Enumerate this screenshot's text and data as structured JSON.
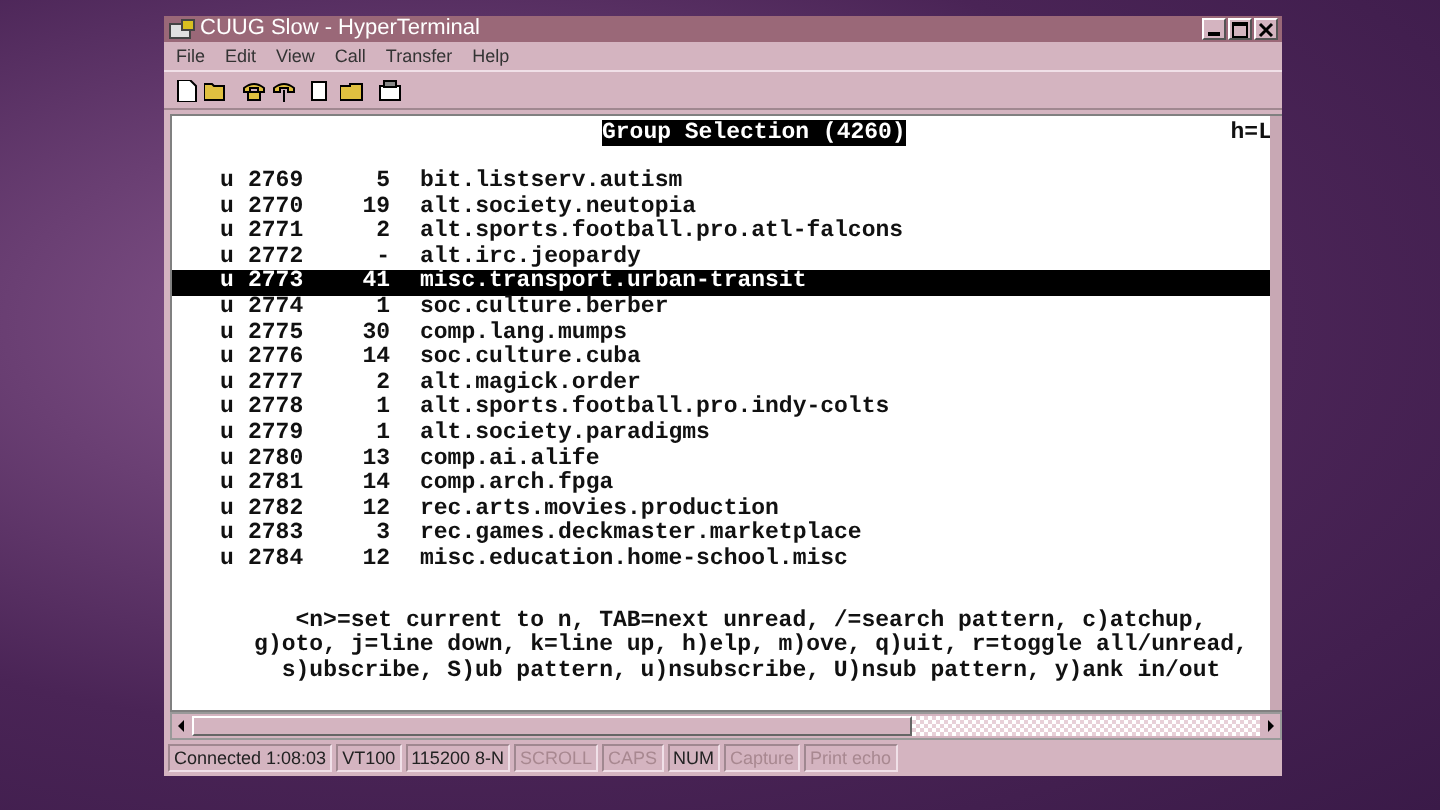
{
  "window": {
    "title": "CUUG Slow - HyperTerminal"
  },
  "menu": [
    "File",
    "Edit",
    "View",
    "Call",
    "Transfer",
    "Help"
  ],
  "terminal": {
    "header": "Group Selection (4260)",
    "header_right": "h=L",
    "rows": [
      {
        "flag": "u",
        "number": "2769",
        "count": "5",
        "group": "bit.listserv.autism",
        "selected": false
      },
      {
        "flag": "u",
        "number": "2770",
        "count": "19",
        "group": "alt.society.neutopia",
        "selected": false
      },
      {
        "flag": "u",
        "number": "2771",
        "count": "2",
        "group": "alt.sports.football.pro.atl-falcons",
        "selected": false
      },
      {
        "flag": "u",
        "number": "2772",
        "count": "-",
        "group": "alt.irc.jeopardy",
        "selected": false
      },
      {
        "flag": "u",
        "number": "2773",
        "count": "41",
        "group": "misc.transport.urban-transit",
        "selected": true
      },
      {
        "flag": "u",
        "number": "2774",
        "count": "1",
        "group": "soc.culture.berber",
        "selected": false
      },
      {
        "flag": "u",
        "number": "2775",
        "count": "30",
        "group": "comp.lang.mumps",
        "selected": false
      },
      {
        "flag": "u",
        "number": "2776",
        "count": "14",
        "group": "soc.culture.cuba",
        "selected": false
      },
      {
        "flag": "u",
        "number": "2777",
        "count": "2",
        "group": "alt.magick.order",
        "selected": false
      },
      {
        "flag": "u",
        "number": "2778",
        "count": "1",
        "group": "alt.sports.football.pro.indy-colts",
        "selected": false
      },
      {
        "flag": "u",
        "number": "2779",
        "count": "1",
        "group": "alt.society.paradigms",
        "selected": false
      },
      {
        "flag": "u",
        "number": "2780",
        "count": "13",
        "group": "comp.ai.alife",
        "selected": false
      },
      {
        "flag": "u",
        "number": "2781",
        "count": "14",
        "group": "comp.arch.fpga",
        "selected": false
      },
      {
        "flag": "u",
        "number": "2782",
        "count": "12",
        "group": "rec.arts.movies.production",
        "selected": false
      },
      {
        "flag": "u",
        "number": "2783",
        "count": "3",
        "group": "rec.games.deckmaster.marketplace",
        "selected": false
      },
      {
        "flag": "u",
        "number": "2784",
        "count": "12",
        "group": "misc.education.home-school.misc",
        "selected": false
      }
    ],
    "help": [
      "<n>=set current to n, TAB=next unread, /=search pattern, c)atchup,",
      "g)oto, j=line down, k=line up, h)elp, m)ove, q)uit, r=toggle all/unread,",
      "s)ubscribe, S)ub pattern, u)nsubscribe, U)nsub pattern, y)ank in/out"
    ]
  },
  "status_bar": [
    {
      "text": "Connected 1:08:03",
      "active": true
    },
    {
      "text": "VT100",
      "active": true
    },
    {
      "text": "115200 8-N",
      "active": true
    },
    {
      "text": "SCROLL",
      "active": false
    },
    {
      "text": "CAPS",
      "active": false
    },
    {
      "text": "NUM",
      "active": true
    },
    {
      "text": "Capture",
      "active": false
    },
    {
      "text": "Print echo",
      "active": false
    }
  ]
}
